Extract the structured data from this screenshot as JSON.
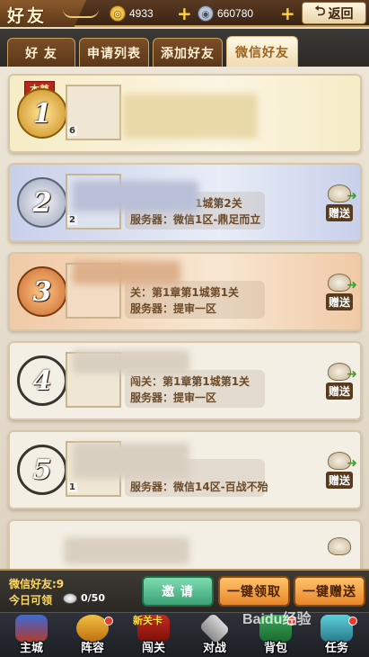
{
  "header": {
    "title": "好友",
    "gold": "4933",
    "silver": "660780",
    "back_label": "返回"
  },
  "tabs": [
    {
      "label": "好 友",
      "active": false
    },
    {
      "label": "申请列表",
      "active": false
    },
    {
      "label": "添加好友",
      "active": false
    },
    {
      "label": "微信好友",
      "active": true
    }
  ],
  "self_tag": "本尊",
  "friends": [
    {
      "rank": "1",
      "level": "6",
      "stage": "",
      "server": "",
      "gift": ""
    },
    {
      "rank": "2",
      "level": "2",
      "stage": "1城第2关",
      "server": "服务器：微信1区-鼎足而立",
      "gift": "赠送"
    },
    {
      "rank": "3",
      "level": "",
      "stage": "关：第1章第1城第1关",
      "server": "服务器：提审一区",
      "gift": "赠送"
    },
    {
      "rank": "4",
      "level": "",
      "stage": "闯关：第1章第1城第1关",
      "server": "服务器：提审一区",
      "gift": "赠送"
    },
    {
      "rank": "5",
      "level": "1",
      "stage": "",
      "server": "服务器：微信14区-百战不殆",
      "gift": "赠送"
    },
    {
      "rank": "",
      "level": "",
      "stage": "",
      "server": "",
      "gift": ""
    }
  ],
  "footer": {
    "friend_count_label": "微信好友:9",
    "today_label": "今日可领",
    "today_count": "0/50",
    "invite": "邀 请",
    "claim_all": "一键领取",
    "gift_all": "一键赠送"
  },
  "nav": [
    {
      "label": "主城",
      "badge": false,
      "tag": ""
    },
    {
      "label": "阵容",
      "badge": true,
      "tag": ""
    },
    {
      "label": "闯关",
      "badge": false,
      "tag": "新关卡"
    },
    {
      "label": "对战",
      "badge": false,
      "tag": ""
    },
    {
      "label": "背包",
      "badge": true,
      "tag": ""
    },
    {
      "label": "任务",
      "badge": true,
      "tag": ""
    }
  ],
  "watermark": "Baidu经验",
  "colors": {
    "rank1": "#f3e7b8",
    "rank2": "#c9d1ea",
    "rank3": "#f1cfae",
    "default": "#f3eee3"
  }
}
